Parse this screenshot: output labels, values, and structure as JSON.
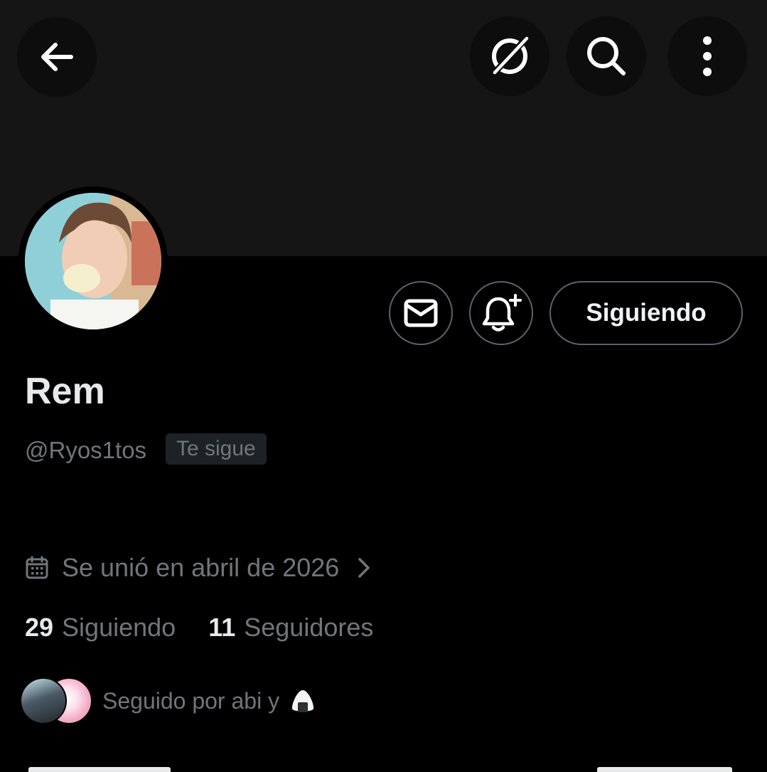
{
  "header": {
    "back_icon": "arrow-left-icon",
    "grok_icon": "grok-icon",
    "search_icon": "search-icon",
    "more_icon": "more-vertical-icon"
  },
  "profile": {
    "name": "Rem",
    "handle": "@Ryos1tos",
    "follows_you_badge": "Te sigue",
    "joined": "Se unió en abril de 2026",
    "following_count": "29",
    "following_label": "Siguiendo",
    "followers_count": "11",
    "followers_label": "Seguidores",
    "followed_by": "Seguido por abi y"
  },
  "actions": {
    "message_icon": "mail-icon",
    "notify_icon": "bell-plus-icon",
    "follow_button_label": "Siguiendo"
  },
  "colors": {
    "background": "#000000",
    "banner": "#151515",
    "text_primary": "#e7e9ea",
    "text_secondary": "#71767b",
    "button_border": "#5b6268"
  }
}
